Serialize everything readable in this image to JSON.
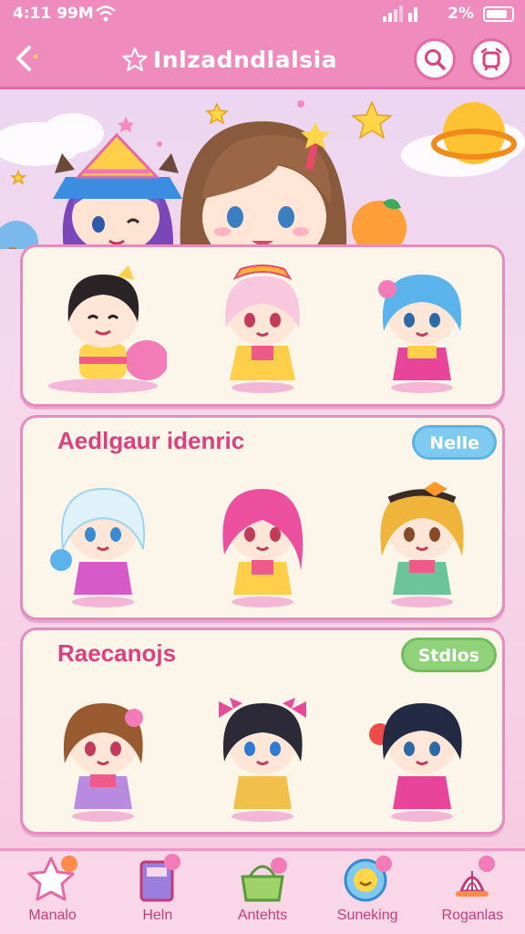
{
  "status_bar": {
    "time": "4:11 99M",
    "battery_text": "2%"
  },
  "header": {
    "title": "Inlzadndlalsia",
    "back_icon": "back-arrow-icon",
    "search_icon": "search-icon",
    "alarm_icon": "alarm-clock-icon"
  },
  "sections": [
    {
      "title": "",
      "tag": ""
    },
    {
      "title": "Aedlgaur idenric",
      "tag": "Nelle"
    },
    {
      "title": "Raecanojs",
      "tag": "Stdlos"
    }
  ],
  "colors": {
    "accent": "#f08bbd",
    "section_title": "#d9417f",
    "tag_blue": "#7ecaf0",
    "tag_green": "#8fd27a"
  },
  "nav": {
    "items": [
      {
        "label": "Manalo",
        "icon": "star-icon"
      },
      {
        "label": "Heln",
        "icon": "book-icon"
      },
      {
        "label": "Antehts",
        "icon": "basket-icon"
      },
      {
        "label": "Suneking",
        "icon": "smiley-icon"
      },
      {
        "label": "Roganlas",
        "icon": "whisk-icon"
      }
    ]
  }
}
